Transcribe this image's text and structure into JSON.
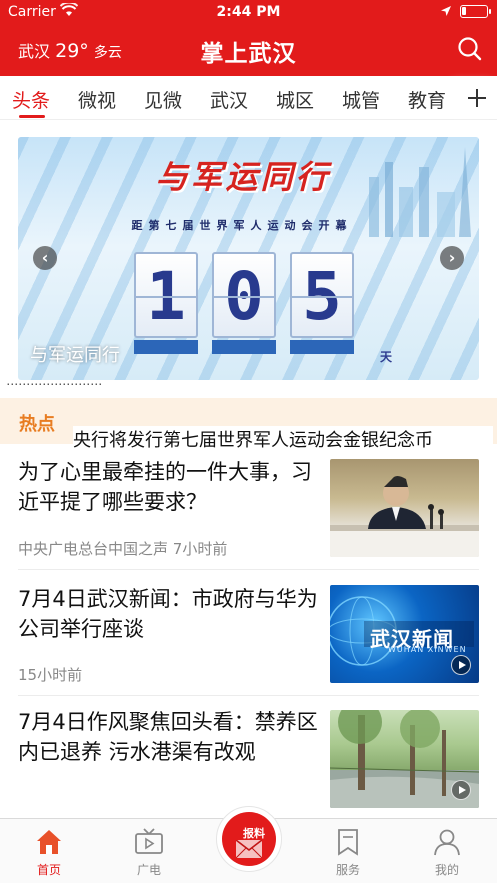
{
  "status_bar": {
    "carrier": "Carrier",
    "time": "2:44 PM"
  },
  "header": {
    "city": "武汉",
    "temperature": "29°",
    "condition": "多云",
    "title": "掌上武汉"
  },
  "tabs": {
    "items": [
      "头条",
      "微视",
      "见微",
      "武汉",
      "城区",
      "城管",
      "教育"
    ],
    "active_index": 0
  },
  "banner": {
    "slogan": "与军运同行",
    "subtitle": "距第七届世界军人运动会开幕",
    "digits": [
      "1",
      "0",
      "5"
    ],
    "unit": "天",
    "caption": "与军运同行"
  },
  "ticker": {
    "peek_text": "“……………………”",
    "badge": "热点",
    "text": "央行将发行第七届世界军人运动会金银纪念币"
  },
  "news": [
    {
      "title": "为了心里最牵挂的一件大事，习近平提了哪些要求？",
      "meta": "中央广电总台中国之声 7小时前",
      "has_video": false
    },
    {
      "title": "7月4日武汉新闻：市政府与华为公司举行座谈",
      "meta": "15小时前",
      "has_video": true,
      "thumb_text": "武汉新闻",
      "thumb_sub": "WUHAN XINWEN"
    },
    {
      "title": "7月4日作风聚焦回头看：禁养区内已退养 污水港渠有改观",
      "meta": "",
      "has_video": true
    }
  ],
  "tabbar": {
    "items": [
      {
        "label": "首页",
        "icon": "home-icon"
      },
      {
        "label": "广电",
        "icon": "tv-icon"
      },
      {
        "label": "服务",
        "icon": "bookmark-icon"
      },
      {
        "label": "我的",
        "icon": "user-icon"
      }
    ],
    "active_index": 0,
    "report_label": "报料"
  },
  "colors": {
    "brand_red": "#e21b1b",
    "hot_orange": "#e87d22",
    "ticker_bg": "#fdf1e3"
  }
}
